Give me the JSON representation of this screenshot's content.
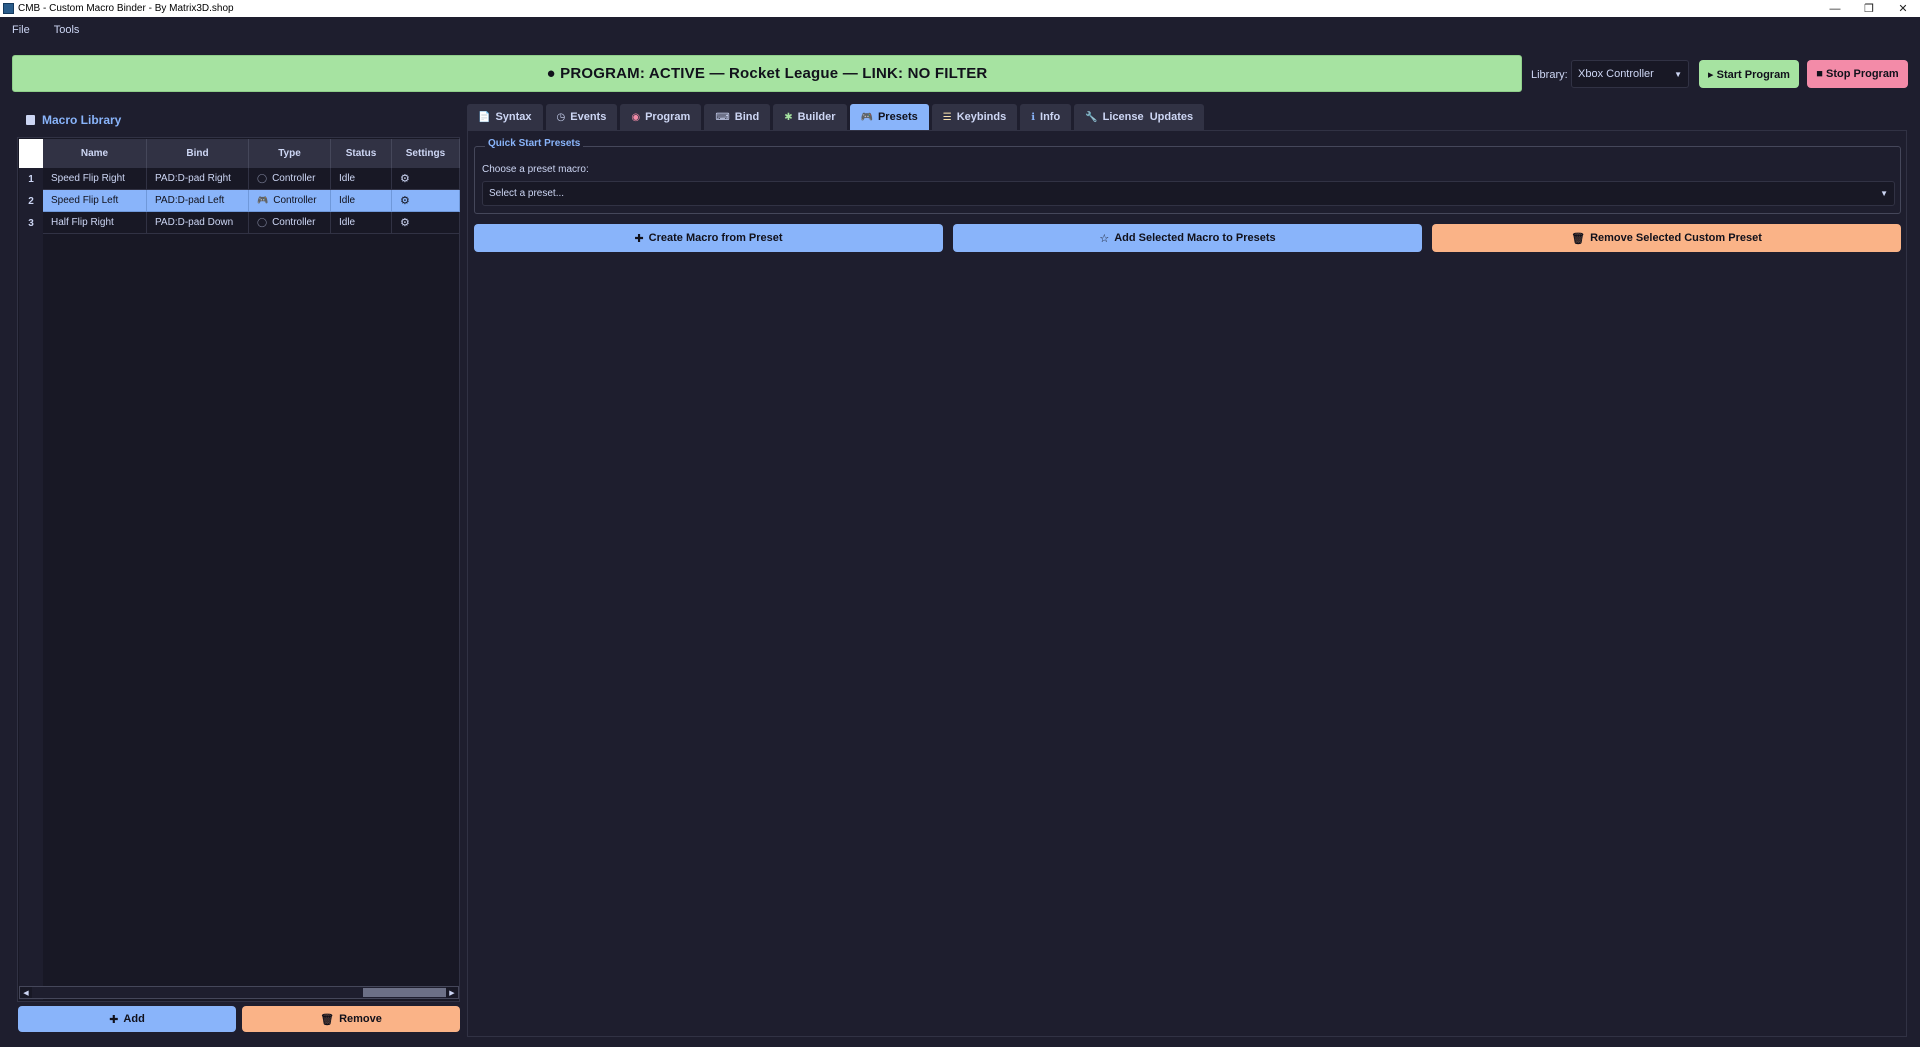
{
  "window": {
    "title": "CMB - Custom Macro Binder - By Matrix3D.shop"
  },
  "menu": {
    "items": [
      "File",
      "Tools"
    ]
  },
  "banner": {
    "text": "● PROGRAM: ACTIVE — Rocket League — LINK: NO FILTER",
    "color": "#a6e3a1"
  },
  "library": {
    "label": "Library:",
    "selected": "Xbox Controller"
  },
  "controls": {
    "start_label": "▸ Start Program",
    "stop_label": "■ Stop Program"
  },
  "macro_library": {
    "title": "Macro Library",
    "columns": [
      "Name",
      "Bind",
      "Type",
      "Status",
      "Settings"
    ],
    "rows": [
      {
        "num": "1",
        "name": "Speed Flip Right",
        "bind": "PAD:D-pad Right",
        "type": "Controller",
        "status": "Idle",
        "selected": false
      },
      {
        "num": "2",
        "name": "Speed Flip Left",
        "bind": "PAD:D-pad Left",
        "type": "Controller",
        "status": "Idle",
        "selected": true
      },
      {
        "num": "3",
        "name": "Half Flip Right",
        "bind": "PAD:D-pad Down",
        "type": "Controller",
        "status": "Idle",
        "selected": false
      }
    ],
    "add_label": "Add",
    "remove_label": "Remove"
  },
  "tabs": [
    {
      "label": "Syntax",
      "icon": "document-icon",
      "active": false
    },
    {
      "label": "Events",
      "icon": "clock-icon",
      "active": false
    },
    {
      "label": "Program",
      "icon": "brain-icon",
      "active": false
    },
    {
      "label": "Bind",
      "icon": "keyboard-icon",
      "active": false
    },
    {
      "label": "Builder",
      "icon": "puzzle-icon",
      "active": false
    },
    {
      "label": "Presets",
      "icon": "gamepad-icon",
      "active": true
    },
    {
      "label": "Keybinds",
      "icon": "list-icon",
      "active": false
    },
    {
      "label": "Info",
      "icon": "info-icon",
      "active": false
    },
    {
      "label": "License  Updates",
      "icon": "wrench-icon",
      "active": false
    }
  ],
  "presets": {
    "group_title": "Quick Start Presets",
    "choose_label": "Choose a preset macro:",
    "select_placeholder": "Select a preset...",
    "create_label": "Create Macro from Preset",
    "add_selected_label": "Add Selected Macro to Presets",
    "remove_custom_label": "Remove Selected Custom Preset"
  },
  "colors": {
    "accent": "#89b4fa",
    "danger": "#f38ba8",
    "warning": "#fab387",
    "success": "#a6e3a1",
    "background": "#1e1e2e"
  }
}
